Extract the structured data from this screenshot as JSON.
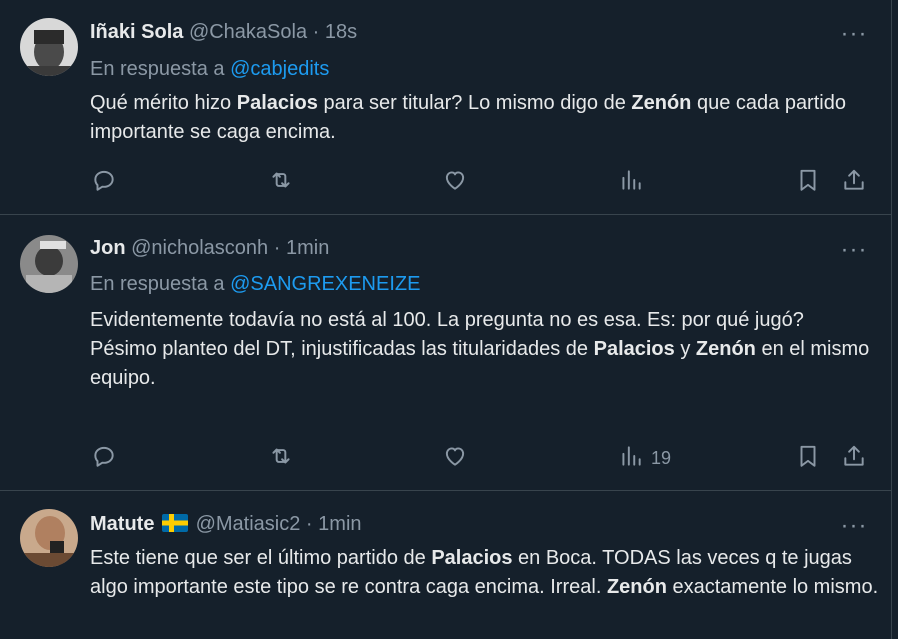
{
  "tweets": [
    {
      "name": "Iñaki Sola",
      "handle": "@ChakaSola",
      "sep": "·",
      "time": "18s",
      "reply_prefix": "En respuesta a",
      "reply_to": "@cabjedits",
      "text": [
        {
          "t": "Qué mérito hizo "
        },
        {
          "t": "Palacios",
          "b": true
        },
        {
          "t": " para ser titular? Lo mismo digo de "
        },
        {
          "t": "Zenón",
          "b": true
        },
        {
          "t": " que cada partido importante se caga encima."
        }
      ],
      "views": ""
    },
    {
      "name": "Jon",
      "handle": "@nicholasconh",
      "sep": "·",
      "time": "1min",
      "reply_prefix": "En respuesta a",
      "reply_to": "@SANGREXENEIZE",
      "text": [
        {
          "t": "Evidentemente todavía no está al 100. La pregunta no es esa.  Es: por qué jugó?\nPésimo planteo del DT, injustificadas las titularidades de "
        },
        {
          "t": "Palacios",
          "b": true
        },
        {
          "t": " y "
        },
        {
          "t": "Zenón",
          "b": true
        },
        {
          "t": " en el mismo equipo."
        }
      ],
      "views": "19"
    },
    {
      "name": "Matute",
      "flag": "sweden-flag",
      "handle": "@Matiasic2",
      "sep": "·",
      "time": "1min",
      "text": [
        {
          "t": "Este tiene que ser el último partido de "
        },
        {
          "t": "Palacios",
          "b": true
        },
        {
          "t": " en Boca. TODAS las veces q te jugas algo importante este tipo se re contra caga encima. Irreal. "
        },
        {
          "t": "Zenón",
          "b": true
        },
        {
          "t": " exactamente lo mismo."
        }
      ]
    }
  ],
  "icons": {
    "reply": "reply-icon",
    "retweet": "retweet-icon",
    "like": "heart-icon",
    "views": "views-icon",
    "bookmark": "bookmark-icon",
    "share": "share-icon",
    "more": "more-icon"
  },
  "colors": {
    "background": "#15202b",
    "text": "#e7e9ea",
    "secondary": "#8b98a5",
    "link": "#1d9bf0",
    "border": "#38444d"
  }
}
